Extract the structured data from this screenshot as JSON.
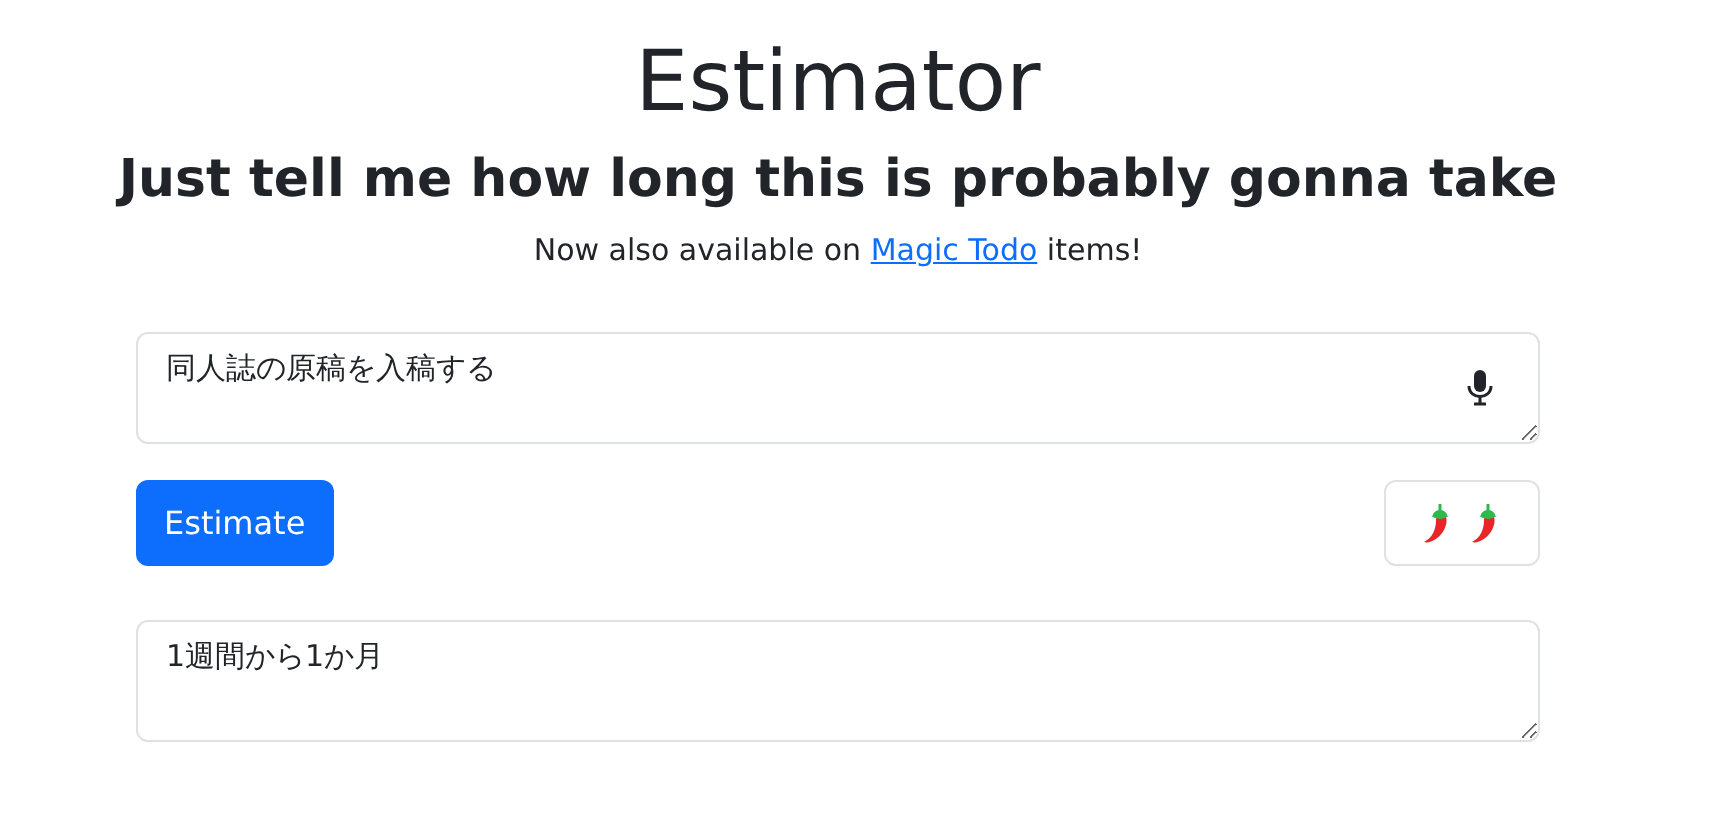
{
  "title": "Estimator",
  "subtitle": "Just tell me how long this is probably gonna take",
  "note": {
    "before": "Now also available on ",
    "link": "Magic Todo",
    "after": " items!"
  },
  "task_input": {
    "value": "同人誌の原稿を入稿する"
  },
  "estimate_button": "Estimate",
  "result": {
    "value": "1週間から1か月"
  }
}
